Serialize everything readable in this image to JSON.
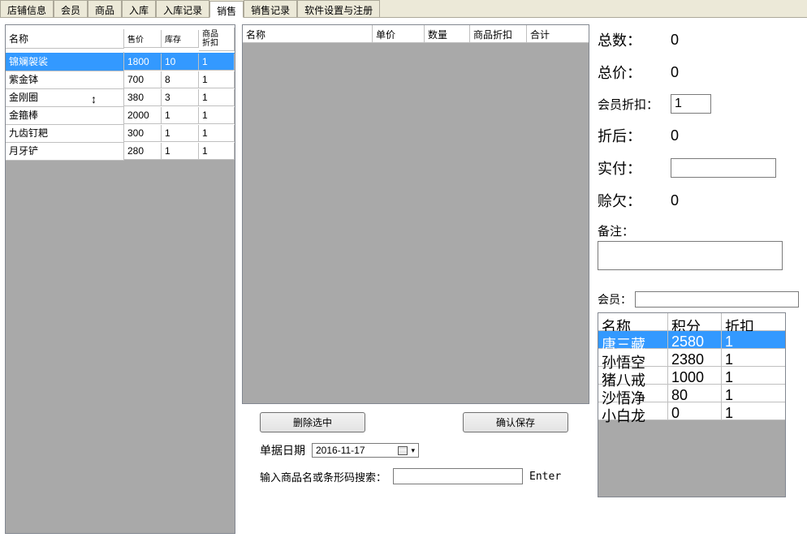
{
  "tabs": [
    "店铺信息",
    "会员",
    "商品",
    "入库",
    "入库记录",
    "销售",
    "销售记录",
    "软件设置与注册"
  ],
  "activeTab": 5,
  "productTable": {
    "headers": {
      "name": "名称",
      "price": "售价",
      "stock": "库存",
      "discount": "商品\n折扣"
    },
    "rows": [
      {
        "name": "锦斓袈裟",
        "price": "1800",
        "stock": "10",
        "discount": "1",
        "sel": true
      },
      {
        "name": "紫金钵",
        "price": "700",
        "stock": "8",
        "discount": "1"
      },
      {
        "name": "金刚圈",
        "price": "380",
        "stock": "3",
        "discount": "1"
      },
      {
        "name": "金箍棒",
        "price": "2000",
        "stock": "1",
        "discount": "1"
      },
      {
        "name": "九齿钉耙",
        "price": "300",
        "stock": "1",
        "discount": "1"
      },
      {
        "name": "月牙铲",
        "price": "280",
        "stock": "1",
        "discount": "1"
      }
    ]
  },
  "cartHeaders": {
    "name": "名称",
    "price": "单价",
    "qty": "数量",
    "discount": "商品折扣",
    "total": "合计"
  },
  "buttons": {
    "delete": "删除选中",
    "confirm": "确认保存"
  },
  "form": {
    "dateLabel": "单据日期",
    "dateValue": "2016-11-17",
    "searchLabel": "输入商品名或条形码搜索：",
    "enterLabel": "Enter"
  },
  "summary": {
    "totalQtyLabel": "总数：",
    "totalQty": "0",
    "totalAmtLabel": "总价：",
    "totalAmt": "0",
    "memberDiscLabel": "会员折扣：",
    "memberDisc": "1",
    "afterDiscLabel": "折后：",
    "afterDisc": "0",
    "paidLabel": "实付：",
    "paid": "",
    "oweLabel": "赊欠：",
    "owe": "0",
    "noteLabel": "备注："
  },
  "memberPanel": {
    "label": "会员：",
    "headers": {
      "name": "名称",
      "points": "积分",
      "discount": "折扣"
    },
    "rows": [
      {
        "name": "唐三藏",
        "points": "2580",
        "discount": "1",
        "sel": true
      },
      {
        "name": "孙悟空",
        "points": "2380",
        "discount": "1"
      },
      {
        "name": "猪八戒",
        "points": "1000",
        "discount": "1"
      },
      {
        "name": "沙悟净",
        "points": "80",
        "discount": "1"
      },
      {
        "name": "小白龙",
        "points": "0",
        "discount": "1"
      }
    ]
  }
}
